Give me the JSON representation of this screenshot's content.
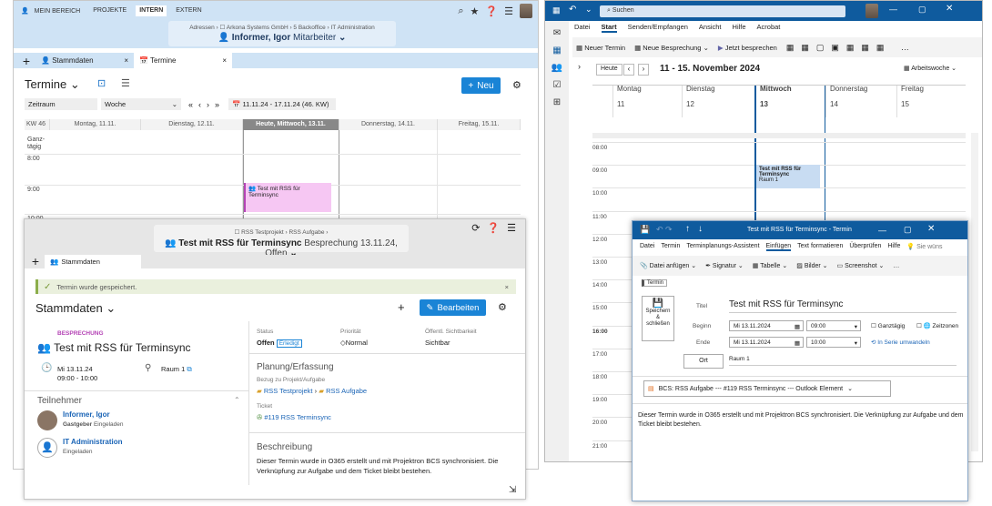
{
  "bcs": {
    "nav": [
      "MEIN BEREICH",
      "PROJEKTE",
      "INTERN",
      "EXTERN"
    ],
    "crumb_path": "Adressen  ›  ☐ Arkona Systems GmbH  ›  5 Backoffice  ›  IT Administration",
    "user_name": "Informer, Igor",
    "user_role": "Mitarbeiter",
    "tab1": "Stammdaten",
    "tab2": "Termine",
    "page_title": "Termine",
    "new_label": "Neu",
    "filter_range_label": "Zeitraum",
    "filter_view": "Woche",
    "date_range": "11.11.24 - 17.11.24 (46. KW)",
    "week_label": "KW 46",
    "days": [
      "Montag, 11.11.",
      "Dienstag, 12.11.",
      "Heute, Mittwoch, 13.11.",
      "Donnerstag, 14.11.",
      "Freitag, 15.11."
    ],
    "allday_label": "Ganz-\ntägig",
    "hours": [
      "8:00",
      "9:00",
      "10:00"
    ],
    "event_title": "Test mit RSS für Terminsync"
  },
  "detail": {
    "crumb_path": "☐ RSS Testprojekt  ›  RSS Aufgabe  ›",
    "title": "Test mit RSS für Terminsync",
    "subtitle": "Besprechung 13.11.24, Offen",
    "tab": "Stammdaten",
    "saved_msg": "Termin wurde gespeichert.",
    "heading": "Stammdaten",
    "edit_label": "Bearbeiten",
    "type_label": "BESPRECHUNG",
    "event_title": "Test mit RSS für Terminsync",
    "date": "Mi 13.11.24",
    "time": "09:00 - 10:00",
    "room": "Raum 1",
    "participants_heading": "Teilnehmer",
    "p1_name": "Informer, Igor",
    "p1_role": "Gastgeber",
    "p1_status": "Eingeladen",
    "p2_name": "IT Administration",
    "p2_status": "Eingeladen",
    "status_label": "Status",
    "status_value": "Offen",
    "status_badge": "Erledigt",
    "prio_label": "Priorität",
    "prio_value": "Normal",
    "vis_label": "Öffentl. Sichtbarkeit",
    "vis_value": "Sichtbar",
    "planning_heading": "Planung/Erfassung",
    "ref_label": "Bezug zu Projekt/Aufgabe",
    "ref_project": "RSS Testprojekt",
    "ref_task": "RSS Aufgabe",
    "ticket_label": "Ticket",
    "ticket_value": "#119 RSS Terminsync",
    "desc_heading": "Beschreibung",
    "desc_text": "Dieser Termin wurde in O365 erstellt und mit Projektron BCS synchronisiert. Die Verknüpfung zur Aufgabe und dem Ticket bleibt bestehen."
  },
  "outlook": {
    "search": "Suchen",
    "menu": [
      "Datei",
      "Start",
      "Senden/Empfangen",
      "Ansicht",
      "Hilfe",
      "Acrobat"
    ],
    "ribbon": [
      "Neuer Termin",
      "Neue Besprechung",
      "Jetzt besprechen"
    ],
    "today_btn": "Heute",
    "range": "11 - 15. November 2024",
    "view": "Arbeitswoche",
    "days": [
      "Montag",
      "Dienstag",
      "Mittwoch",
      "Donnerstag",
      "Freitag"
    ],
    "dates": [
      "11",
      "12",
      "13",
      "14",
      "15"
    ],
    "hours": [
      "08:00",
      "09:00",
      "10:00",
      "11:00",
      "12:00",
      "13:00",
      "14:00",
      "15:00",
      "16:00",
      "17:00",
      "18:00",
      "19:00",
      "20:00",
      "21:00"
    ],
    "event_title": "Test mit RSS für Terminsync",
    "event_room": "Raum 1"
  },
  "appointment": {
    "title": "Test mit RSS für Terminsync  -  Termin",
    "menu": [
      "Datei",
      "Termin",
      "Terminplanungs-Assistent",
      "Einfügen",
      "Text formatieren",
      "Überprüfen",
      "Hilfe"
    ],
    "tell": "Sie wüns",
    "ribbon": [
      "Datei anfügen",
      "Signatur",
      "Tabelle",
      "Bilder",
      "Screenshot"
    ],
    "tag": "Termin",
    "save_label": "Speichern\n&\nschließen",
    "title_label": "Titel",
    "title_value": "Test mit RSS für Terminsync",
    "begin_label": "Beginn",
    "begin_date": "Mi 13.11.2024",
    "begin_time": "09:00",
    "end_label": "Ende",
    "end_date": "Mi 13.11.2024",
    "end_time": "10:00",
    "allday": "Ganztägig",
    "timezones": "Zeitzonen",
    "series": "In Serie umwandeln",
    "location_label": "Ort",
    "location_value": "Raum 1",
    "bcs_link": "BCS: RSS Aufgabe --- #119 RSS Terminsync --- Outlook Element",
    "body": "Dieser Termin wurde in O365 erstellt und mit Projektron BCS synchronisiert. Die Verknüpfung zur Aufgabe und dem Ticket bleibt bestehen."
  }
}
